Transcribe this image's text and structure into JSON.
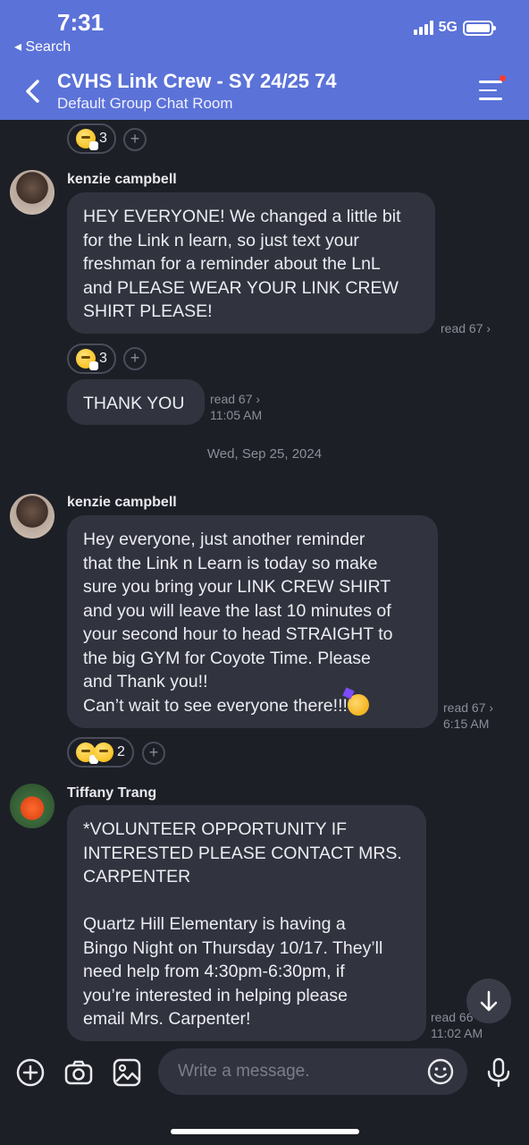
{
  "status": {
    "time": "7:31",
    "back_label": "◂ Search",
    "network": "5G"
  },
  "header": {
    "title": "CVHS Link Crew - SY 24/25 74",
    "subtitle": "Default Group Chat Room"
  },
  "messages": {
    "reaction_top_count": "3",
    "m1": {
      "sender": "kenzie campbell",
      "text": "HEY EVERYONE! We changed a little bit\nfor the Link n learn, so just text your\nfreshman for a reminder about the LnL\nand PLEASE WEAR YOUR LINK CREW\nSHIRT PLEASE!",
      "read": "read 67 ›",
      "reaction_count": "3"
    },
    "m2": {
      "text": "THANK YOU",
      "read": "read 67 ›",
      "time": "11:05 AM"
    },
    "date_separator": "Wed, Sep 25, 2024",
    "m3": {
      "sender": "kenzie campbell",
      "text": "Hey everyone, just another reminder\nthat the Link n Learn is today so make\nsure you bring your LINK CREW SHIRT\nand you will leave the last 10 minutes of\nyour second hour to head STRAIGHT to\nthe big GYM for Coyote Time. Please\nand Thank you!!\nCan’t wait to see everyone there!!!",
      "read": "read 67 ›",
      "time": "6:15 AM",
      "reaction_count": "2"
    },
    "m4": {
      "sender": "Tiffany Trang",
      "text": "*VOLUNTEER OPPORTUNITY IF\nINTERESTED PLEASE CONTACT MRS.\nCARPENTER\n\nQuartz Hill Elementary is having a\nBingo Night on Thursday 10/17. They’ll\nneed help from 4:30pm-6:30pm, if\nyou’re interested in helping please\nemail Mrs. Carpenter!",
      "read": "read 66",
      "time": "11:02 AM"
    }
  },
  "composer": {
    "placeholder": "Write a message."
  },
  "colors": {
    "header_bg": "#5b72d8",
    "chat_bg": "#1d1f27",
    "bubble_bg": "#31343f"
  }
}
